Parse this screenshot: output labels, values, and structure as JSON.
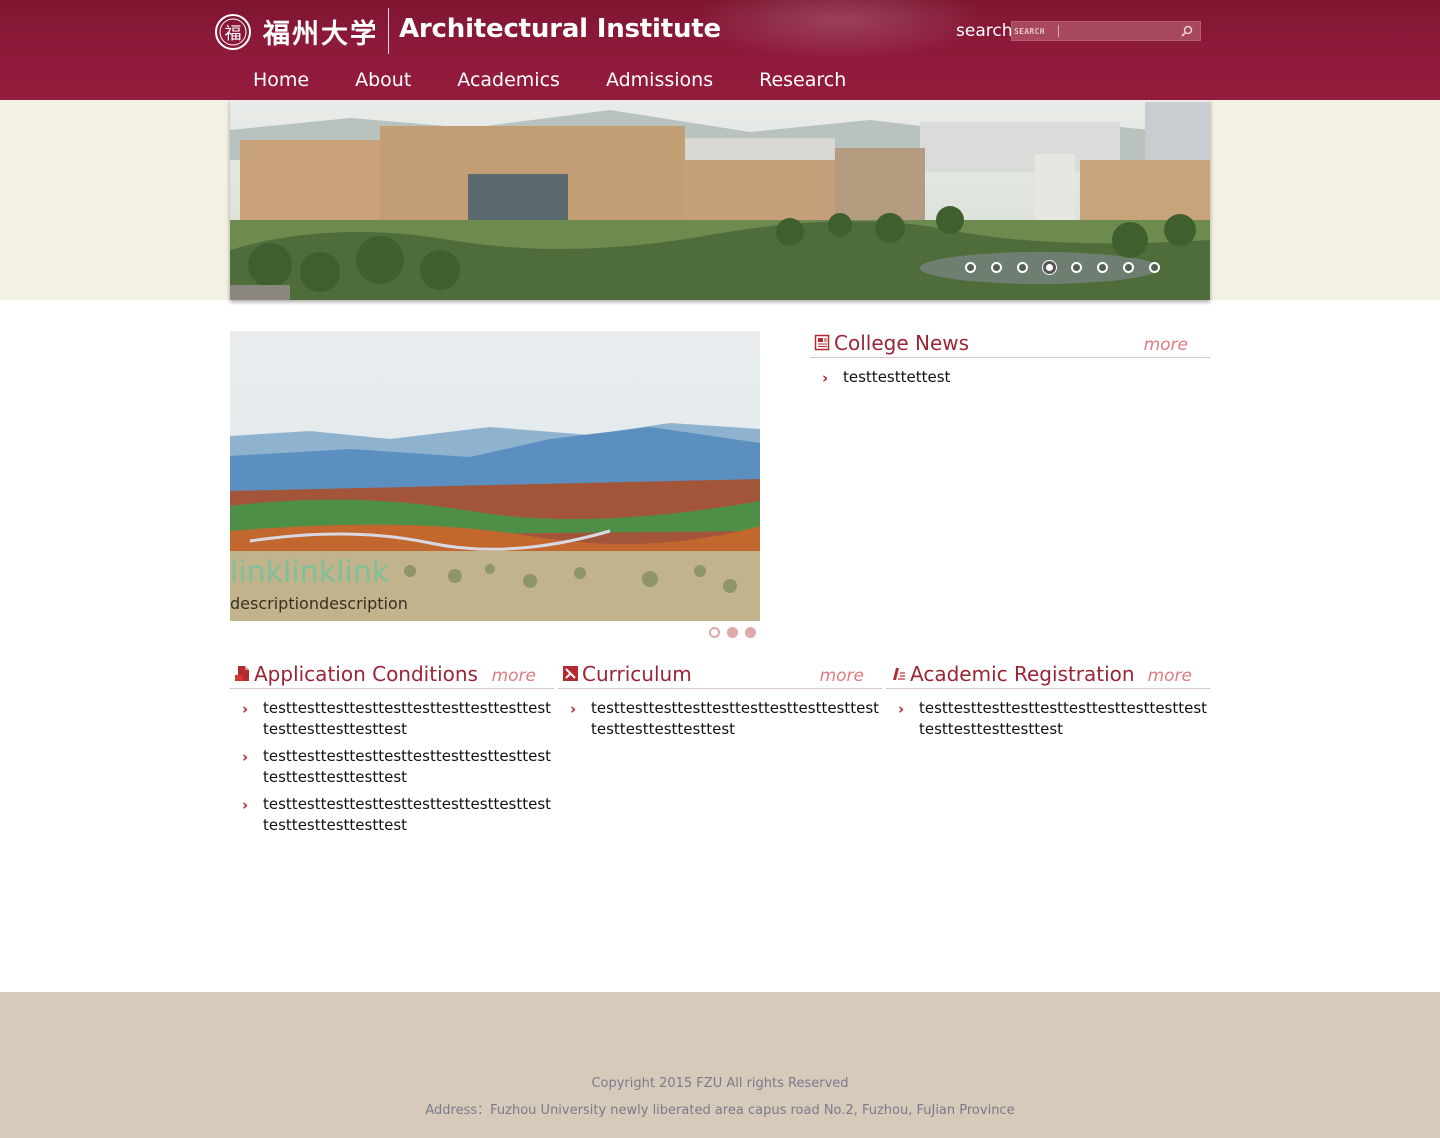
{
  "header": {
    "logo": {
      "seal": "福",
      "wordmark": "福州大学"
    },
    "title": "Architectural Institute",
    "search_label": "search",
    "search_placeholder": "SEARCH"
  },
  "nav": [
    "Home",
    "About",
    "Academics",
    "Admissions",
    "Research"
  ],
  "banner": {
    "dot_count": 8,
    "active_index": 3
  },
  "feature": {
    "link": "linklinklink",
    "description": "descriptiondescription",
    "dot_count": 3,
    "active_index": 0
  },
  "college_news": {
    "title": "College News",
    "more": "more",
    "items": [
      "testtesttettest"
    ]
  },
  "sections": [
    {
      "title": "Application Conditions",
      "more": "more",
      "icon": "document-icon",
      "items": [
        "testtesttesttesttesttesttesttesttesttesttesttesttesttesttest",
        "testtesttesttesttesttesttesttesttesttesttesttesttesttesttest",
        "testtesttesttesttesttesttesttesttesttesttesttesttesttesttest"
      ]
    },
    {
      "title": "Curriculum",
      "more": "more",
      "icon": "book-icon",
      "items": [
        "testtesttesttesttesttesttesttesttesttesttesttesttesttesttest"
      ]
    },
    {
      "title": "Academic Registration",
      "more": "more",
      "icon": "pen-icon",
      "items": [
        "testtesttesttesttesttesttesttesttesttesttesttesttesttesttest"
      ]
    }
  ],
  "footer": {
    "copyright": "Copyright 2015 FZU All rights Reserved",
    "address": "Address：Fuzhou University newly liberated area capus road No.2, Fuzhou, FuJian Province"
  },
  "colors": {
    "header": "#8e1a3a",
    "accent": "#9a2535",
    "more": "#e07a80",
    "footer": "#d6cbbb"
  }
}
